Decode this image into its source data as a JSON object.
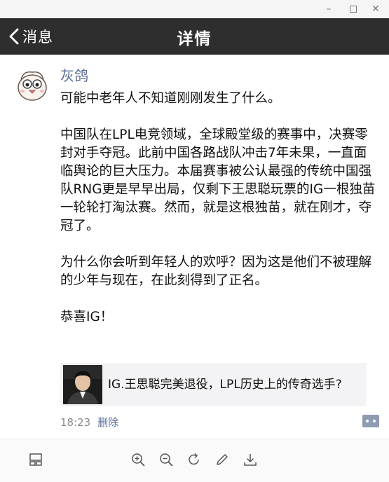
{
  "window": {
    "minimize_glyph": "–",
    "close_glyph": "✕"
  },
  "nav": {
    "back_label": "消息",
    "title": "详情"
  },
  "post": {
    "author": "灰鸽",
    "paragraphs": [
      "可能中老年人不知道刚刚发生了什么。",
      "中国队在LPL电竞领域，全球殿堂级的赛事中，决赛零封对手夺冠。此前中国各路战队冲击7年未果，一直面临舆论的巨大压力。本届赛事被公认最强的传统中国强队RNG更是早早出局，仅剩下王思聪玩票的IG一根独苗一轮轮打淘汰赛。然而，就是这根独苗，就在刚才，夺冠了。",
      "为什么你会听到年轻人的欢呼？因为这是他们不被理解的少年与现在，在此刻得到了正名。",
      "恭喜IG！"
    ],
    "link_title": "IG.王思聪完美退役，LPL历史上的传奇选手?",
    "time": "18:23",
    "delete_label": "删除"
  },
  "icons": {
    "toolbar": [
      "sidebar-toggle-icon",
      "zoom-in-icon",
      "zoom-out-icon",
      "rotate-icon",
      "edit-icon",
      "download-icon"
    ]
  },
  "colors": {
    "navbar_bg": "#2e2e2e",
    "link_blue": "#576b95",
    "card_bg": "#f3f3f5"
  }
}
